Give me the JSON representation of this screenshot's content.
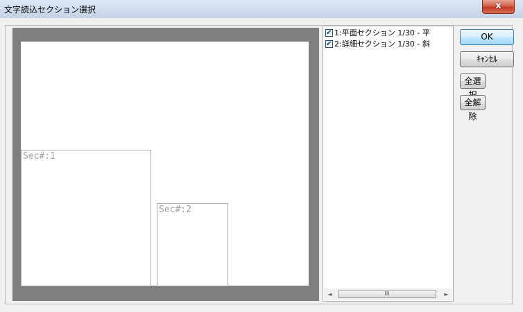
{
  "window": {
    "title": "文字読込セクション選択",
    "close_symbol": "x"
  },
  "preview": {
    "sections": [
      {
        "label": "Sec#:1"
      },
      {
        "label": "Sec#:2"
      }
    ]
  },
  "list": {
    "items": [
      {
        "label": "1:平面セクション 1/30 - 平",
        "checked": true
      },
      {
        "label": "2:詳細セクション 1/30 - 斜",
        "checked": true
      }
    ],
    "scroll_left": "◄",
    "scroll_right": "►",
    "thumb_grip": "III"
  },
  "buttons": {
    "ok": "OK",
    "cancel": "ｷｬﾝｾﾙ",
    "select_all": "全選択",
    "deselect_all": "全解除"
  }
}
